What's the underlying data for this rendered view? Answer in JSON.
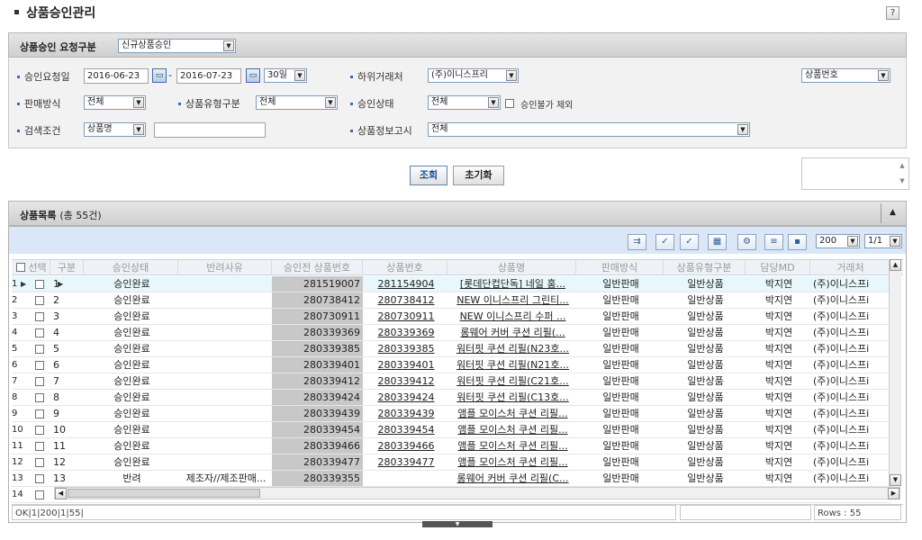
{
  "page": {
    "title": "상품승인관리",
    "help": "?"
  },
  "request_panel": {
    "label": "상품승인 요청구분",
    "type_value": "신규상품승인"
  },
  "filters": {
    "request_date_label": "승인요청일",
    "date_from": "2016-06-23",
    "date_to": "2016-07-23",
    "date_sep": "-",
    "period": "30일",
    "vendor_label": "하위거래처",
    "vendor_value": "(주)이니스프리",
    "sort_key": "상품번호",
    "sales_method_label": "판매방식",
    "sales_method_value": "전체",
    "product_type_label": "상품유형구분",
    "product_type_value": "전체",
    "approval_status_label": "승인상태",
    "approval_status_value": "전체",
    "exclude_rejected_label": "승인불가 제외",
    "search_cond_label": "검색조건",
    "search_cond_value": "상품명",
    "search_text": "",
    "info_notice_label": "상품정보고시",
    "info_notice_value": "전체"
  },
  "buttons": {
    "search": "조회",
    "reset": "초기화"
  },
  "list": {
    "label": "상품목록",
    "count_text": "(총 55건)",
    "collapse": "▲",
    "page_size": "200",
    "page": "1/1",
    "columns": [
      "선택",
      "구분",
      "승인상태",
      "반려사유",
      "승인전 상품번호",
      "상품번호",
      "상품명",
      "판매방식",
      "상품유형구분",
      "담당MD",
      "거래처"
    ],
    "rows": [
      {
        "no": "1",
        "seq": "1",
        "status": "승인완료",
        "reason": "",
        "pre_no": "281519007",
        "prod_no": "281154904",
        "name": "[롯데단컵단독] 네일 홍...",
        "method": "일반판매",
        "type": "일반상품",
        "md": "박지연",
        "vendor": "(주)이니스프i"
      },
      {
        "no": "2",
        "seq": "2",
        "status": "승인완료",
        "reason": "",
        "pre_no": "280738412",
        "prod_no": "280738412",
        "name": "NEW 이니스프리 그린티...",
        "method": "일반판매",
        "type": "일반상품",
        "md": "박지연",
        "vendor": "(주)이니스프i"
      },
      {
        "no": "3",
        "seq": "3",
        "status": "승인완료",
        "reason": "",
        "pre_no": "280730911",
        "prod_no": "280730911",
        "name": "NEW 이니스프리 수퍼 ...",
        "method": "일반판매",
        "type": "일반상품",
        "md": "박지연",
        "vendor": "(주)이니스프i"
      },
      {
        "no": "4",
        "seq": "4",
        "status": "승인완료",
        "reason": "",
        "pre_no": "280339369",
        "prod_no": "280339369",
        "name": "롱웨어 커버 쿠션 리필(...",
        "method": "일반판매",
        "type": "일반상품",
        "md": "박지연",
        "vendor": "(주)이니스프i"
      },
      {
        "no": "5",
        "seq": "5",
        "status": "승인완료",
        "reason": "",
        "pre_no": "280339385",
        "prod_no": "280339385",
        "name": "워터핏 쿠션 리필(N23호...",
        "method": "일반판매",
        "type": "일반상품",
        "md": "박지연",
        "vendor": "(주)이니스프i"
      },
      {
        "no": "6",
        "seq": "6",
        "status": "승인완료",
        "reason": "",
        "pre_no": "280339401",
        "prod_no": "280339401",
        "name": "워터핏 쿠션 리필(N21호...",
        "method": "일반판매",
        "type": "일반상품",
        "md": "박지연",
        "vendor": "(주)이니스프i"
      },
      {
        "no": "7",
        "seq": "7",
        "status": "승인완료",
        "reason": "",
        "pre_no": "280339412",
        "prod_no": "280339412",
        "name": "워터핏 쿠션 리필(C21호...",
        "method": "일반판매",
        "type": "일반상품",
        "md": "박지연",
        "vendor": "(주)이니스프i"
      },
      {
        "no": "8",
        "seq": "8",
        "status": "승인완료",
        "reason": "",
        "pre_no": "280339424",
        "prod_no": "280339424",
        "name": "워터핏 쿠션 리필(C13호...",
        "method": "일반판매",
        "type": "일반상품",
        "md": "박지연",
        "vendor": "(주)이니스프i"
      },
      {
        "no": "9",
        "seq": "9",
        "status": "승인완료",
        "reason": "",
        "pre_no": "280339439",
        "prod_no": "280339439",
        "name": "앰플 모이스처 쿠션 리필...",
        "method": "일반판매",
        "type": "일반상품",
        "md": "박지연",
        "vendor": "(주)이니스프i"
      },
      {
        "no": "10",
        "seq": "10",
        "status": "승인완료",
        "reason": "",
        "pre_no": "280339454",
        "prod_no": "280339454",
        "name": "앰플 모이스처 쿠션 리필...",
        "method": "일반판매",
        "type": "일반상품",
        "md": "박지연",
        "vendor": "(주)이니스프i"
      },
      {
        "no": "11",
        "seq": "11",
        "status": "승인완료",
        "reason": "",
        "pre_no": "280339466",
        "prod_no": "280339466",
        "name": "앰플 모이스처 쿠션 리필...",
        "method": "일반판매",
        "type": "일반상품",
        "md": "박지연",
        "vendor": "(주)이니스프i"
      },
      {
        "no": "12",
        "seq": "12",
        "status": "승인완료",
        "reason": "",
        "pre_no": "280339477",
        "prod_no": "280339477",
        "name": "앰플 모이스처 쿠션 리필...",
        "method": "일반판매",
        "type": "일반상품",
        "md": "박지연",
        "vendor": "(주)이니스프i"
      },
      {
        "no": "13",
        "seq": "13",
        "status": "반려",
        "reason": "제조자//제조판매...",
        "pre_no": "280339355",
        "prod_no": "",
        "name": "롱웨어 커버 쿠션 리필(C...",
        "method": "일반판매",
        "type": "일반상품",
        "md": "박지연",
        "vendor": "(주)이니스프i"
      },
      {
        "no": "14",
        "seq": "",
        "status": "",
        "reason": "",
        "pre_no": "",
        "prod_no": "",
        "name": "",
        "method": "",
        "type": "",
        "md": "",
        "vendor": ""
      }
    ]
  },
  "status_bar": {
    "left": "OK|1|200|1|55|",
    "rows": "Rows : 55"
  },
  "colors": {
    "selected_row": "#e8f7fb",
    "pre_no_bg": "#c8c8c8",
    "toolbar": "#d9e7f6",
    "accent": "#3a6cb0"
  },
  "icons": [
    "export-excel-icon",
    "check-icon",
    "double-check-icon",
    "lock-icon",
    "settings-icon",
    "list-view-icon",
    "grid-view-icon"
  ]
}
